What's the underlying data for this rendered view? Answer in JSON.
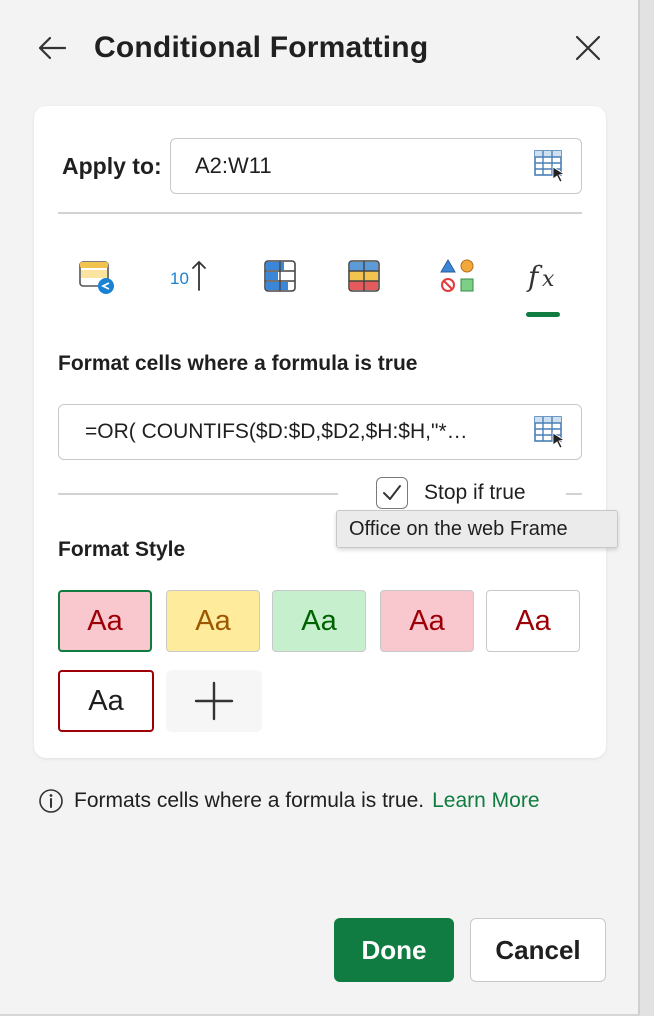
{
  "header": {
    "title": "Conditional Formatting",
    "back_icon": "back-arrow-icon",
    "close_icon": "close-icon"
  },
  "apply_to": {
    "label": "Apply to:",
    "value": "A2:W11",
    "picker_icon": "range-select-icon"
  },
  "rule_types": [
    {
      "name": "highlight-cells-rules-icon"
    },
    {
      "name": "top-bottom-rules-icon",
      "text": "10"
    },
    {
      "name": "data-bars-icon"
    },
    {
      "name": "color-scales-icon"
    },
    {
      "name": "icon-sets-icon"
    },
    {
      "name": "formula-icon",
      "selected": true
    }
  ],
  "formula_section": {
    "label": "Format cells where a formula is true",
    "formula": "=OR( COUNTIFS($D:$D,$D2,$H:$H,\"*…"
  },
  "stop_if_true": {
    "label": "Stop if true",
    "checked": true
  },
  "format_style": {
    "label": "Format Style",
    "swatches": [
      {
        "text": "Aa",
        "bg": "#f9c7ce",
        "color": "#9c0006",
        "border": "#107c41",
        "selected": true
      },
      {
        "text": "Aa",
        "bg": "#ffeb9c",
        "color": "#9c5700",
        "border": "#c9c9c9"
      },
      {
        "text": "Aa",
        "bg": "#c6efce",
        "color": "#006100",
        "border": "#c9c9c9"
      },
      {
        "text": "Aa",
        "bg": "#f9c7ce",
        "color": "#9c0006",
        "border": "#c9c9c9"
      },
      {
        "text": "Aa",
        "bg": "#ffffff",
        "color": "#9c0006",
        "border": "#c9c9c9"
      }
    ],
    "second_row": [
      {
        "text": "Aa",
        "bg": "#ffffff",
        "color": "#1f1f1f",
        "border": "#9c0006"
      }
    ],
    "add_icon": "plus-icon",
    "tooltip": "Office on the web Frame"
  },
  "info": {
    "text": "Formats cells where a formula is true.",
    "link": "Learn More"
  },
  "buttons": {
    "done": "Done",
    "cancel": "Cancel"
  },
  "colors": {
    "accent": "#107c41"
  }
}
